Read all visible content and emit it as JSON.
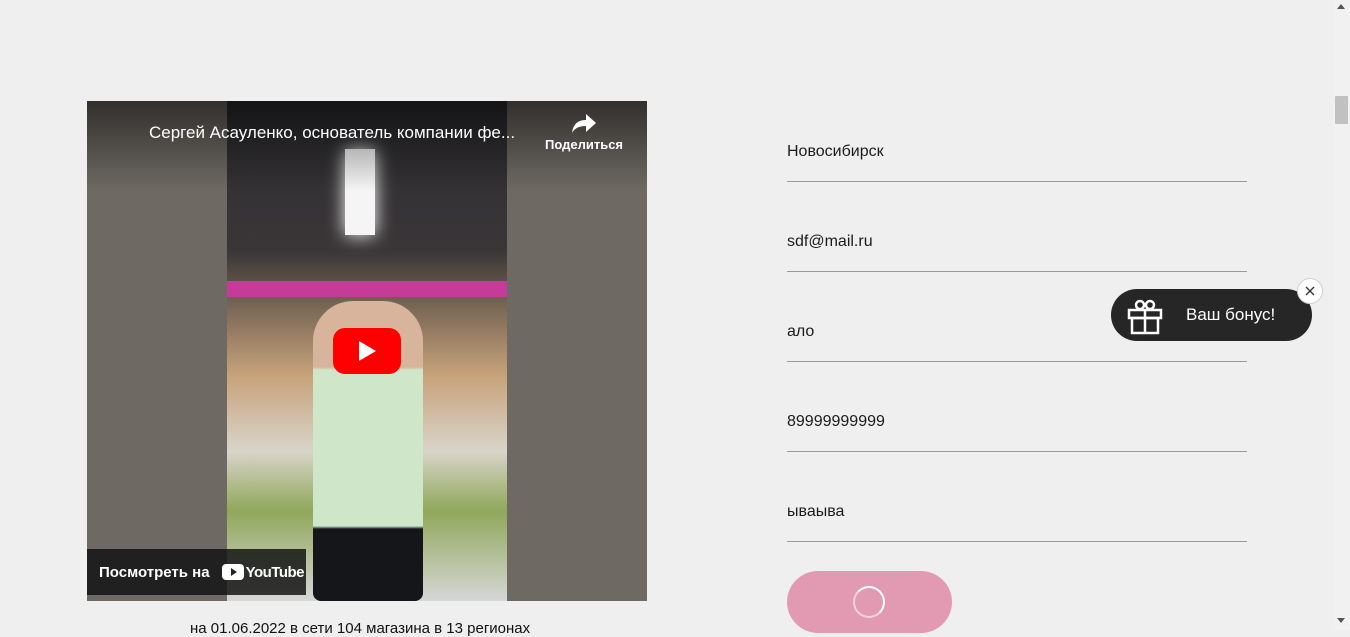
{
  "video": {
    "title": "Сергей Асауленко, основатель компании фе...",
    "share_label": "Поделиться",
    "watch_on_label": "Посмотреть на",
    "youtube_label": "YouTube",
    "play_icon": "play-icon",
    "share_icon": "share-icon"
  },
  "caption": "на 01.06.2022 в сети 104 магазина в 13 регионах",
  "form": {
    "fields": [
      {
        "value": "Новосибирск"
      },
      {
        "value": "sdf@mail.ru"
      },
      {
        "value": "ало"
      },
      {
        "value": "89999999999"
      },
      {
        "value": "ываыва"
      }
    ],
    "submit_state": "loading",
    "submit_color": "#e29ab3"
  },
  "bonus": {
    "label": "Ваш бонус!",
    "icon": "gift-icon",
    "close_icon": "close-icon"
  },
  "colors": {
    "background": "#efefef",
    "youtube_red": "#ff0000",
    "bonus_bg": "#262626"
  }
}
